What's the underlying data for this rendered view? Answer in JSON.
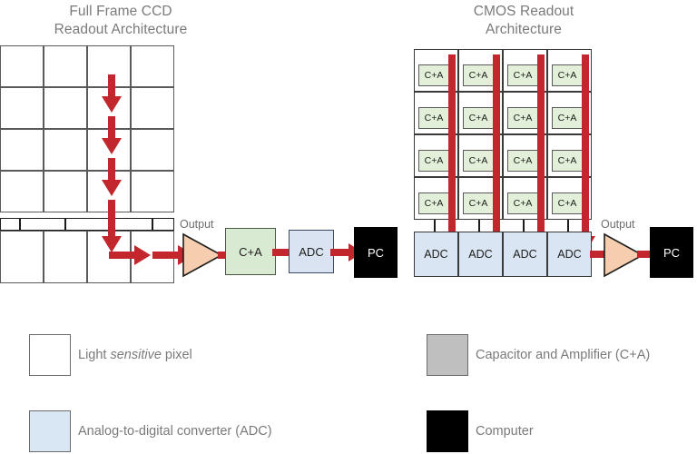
{
  "titles": {
    "ccd": "Full Frame CCD\nReadout Architecture",
    "cmos": "CMOS Readout\nArchitecture"
  },
  "labels": {
    "output": "Output",
    "ca": "C+A",
    "adc": "ADC",
    "pc": "PC"
  },
  "ccd": {
    "grid": {
      "rows": 5,
      "cols": 4
    },
    "separator_row": true,
    "amp_label": "Output",
    "chain": [
      {
        "name": "capacitor-amplifier",
        "label": "C+A",
        "color": "#d9ead3"
      },
      {
        "name": "analog-digital-converter",
        "label": "ADC",
        "color": "#dae3f2"
      },
      {
        "name": "computer",
        "label": "PC",
        "color": "#000000"
      }
    ],
    "vertical_arrows": 4,
    "horizontal_arrows": 4
  },
  "cmos": {
    "grid": {
      "rows": 4,
      "cols": 4
    },
    "pixel_label": "C+A",
    "amp_label": "Output",
    "adc_row": [
      "ADC",
      "ADC",
      "ADC",
      "ADC"
    ],
    "pc_label": "PC",
    "column_arrows": 4
  },
  "legend": {
    "items": [
      {
        "name": "light-sensitive-pixel",
        "color": "#ffffff",
        "text_pre": "Light ",
        "text_italic": "sensitive",
        "text_post": " pixel"
      },
      {
        "name": "capacitor-and-amplifier",
        "color": "#bfbfbf",
        "text_pre": "Capacitor and Amplifier (C+A)",
        "text_italic": "",
        "text_post": ""
      },
      {
        "name": "analog-to-digital-converter",
        "color": "#d9e6f3",
        "text_pre": "Analog-to-digital converter (ADC)",
        "text_italic": "",
        "text_post": ""
      },
      {
        "name": "computer",
        "color": "#000000",
        "text_pre": "Computer",
        "text_italic": "",
        "text_post": ""
      }
    ]
  },
  "colors": {
    "arrow_red": "#c1272d",
    "amp_fill": "#f7cdb0",
    "ca_fill": "#e2efd9",
    "adc_fill": "#dae5f3",
    "text_gray": "#7a7a7a"
  }
}
